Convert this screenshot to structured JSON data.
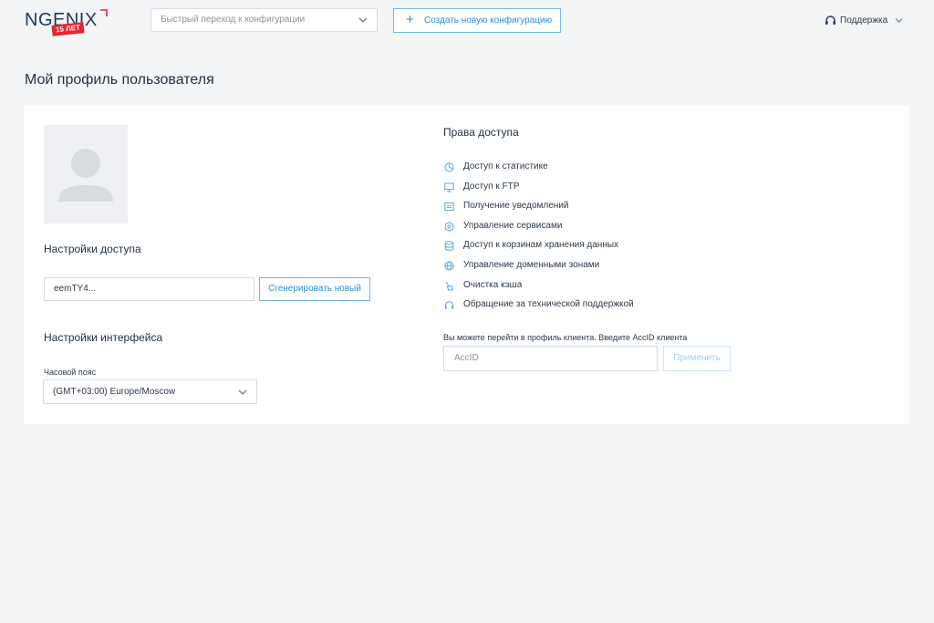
{
  "header": {
    "logo_text": "NGENIX",
    "logo_badge": "15 ЛЕТ",
    "quick_jump_placeholder": "Быстрый переход к конфигурации",
    "create_button_label": "Создать новую конфигурацию",
    "support_label": "Поддержка"
  },
  "page": {
    "title": "Мой профиль пользователя"
  },
  "access_settings": {
    "title": "Настройки доступа",
    "token_value": "eemTY4...",
    "generate_button_label": "Сгенерировать новый"
  },
  "interface_settings": {
    "title": "Настройки интерфейса",
    "timezone_label": "Часовой пояс",
    "timezone_value": "(GMT+03:00) Europe/Moscow"
  },
  "permissions": {
    "title": "Права доступа",
    "items": [
      {
        "label": "Доступ к статистике",
        "icon": "pie-chart-icon"
      },
      {
        "label": "Доступ к FTP",
        "icon": "monitor-icon"
      },
      {
        "label": "Получение уведомлений",
        "icon": "notification-icon"
      },
      {
        "label": "Управление сервисами",
        "icon": "gear-icon"
      },
      {
        "label": "Доступ к корзинам хранения данных",
        "icon": "database-icon"
      },
      {
        "label": "Управление доменными зонами",
        "icon": "globe-icon"
      },
      {
        "label": "Очистка кэша",
        "icon": "broom-icon"
      },
      {
        "label": "Обращение за технической поддержкой",
        "icon": "headset-icon"
      }
    ]
  },
  "client_switch": {
    "hint": "Вы можете перейти в профиль клиента. Введите AccID клиента",
    "input_placeholder": "AccID",
    "apply_button_label": "Применить"
  },
  "colors": {
    "accent": "#2a8fd6",
    "brand_red": "#e3262e",
    "background": "#f4f5f7",
    "icon_blue": "#5aa9df"
  }
}
